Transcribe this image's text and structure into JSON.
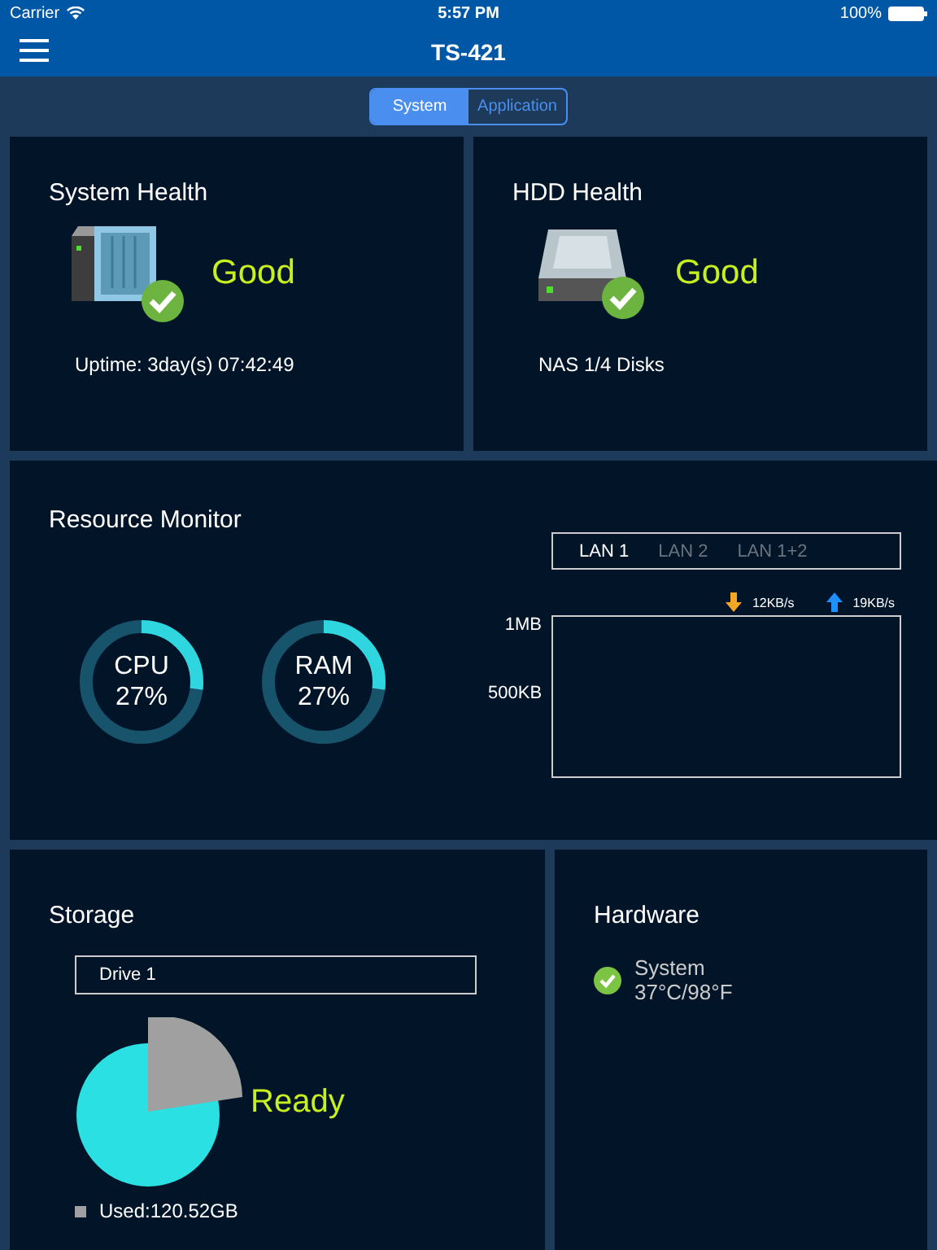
{
  "status_bar": {
    "carrier": "Carrier",
    "time": "5:57 PM",
    "battery": "100%"
  },
  "nav": {
    "title": "TS-421"
  },
  "tabs": [
    {
      "label": "System",
      "selected": true
    },
    {
      "label": "Application",
      "selected": false
    }
  ],
  "system_health": {
    "title": "System Health",
    "status": "Good",
    "uptime": "Uptime: 3day(s)  07:42:49"
  },
  "hdd_health": {
    "title": "HDD Health",
    "status": "Good",
    "disks": "NAS 1/4 Disks"
  },
  "resource_monitor": {
    "title": "Resource Monitor",
    "gauges": [
      {
        "name": "CPU",
        "value": "27%",
        "level": 0.27
      },
      {
        "name": "RAM",
        "value": "27%",
        "level": 0.27
      }
    ],
    "lan_tabs": [
      {
        "label": "LAN 1",
        "selected": true
      },
      {
        "label": "LAN 2",
        "selected": false
      },
      {
        "label": "LAN 1+2",
        "selected": false
      }
    ],
    "download": "12KB/s",
    "upload": "19KB/s",
    "y_labels": [
      "1MB",
      "500KB"
    ]
  },
  "storage": {
    "title": "Storage",
    "drive": "Drive 1",
    "status": "Ready",
    "used": "Used:120.52GB"
  },
  "hardware": {
    "title": "Hardware",
    "items": [
      {
        "name": "System",
        "value": "37°C/98°F"
      }
    ]
  }
}
